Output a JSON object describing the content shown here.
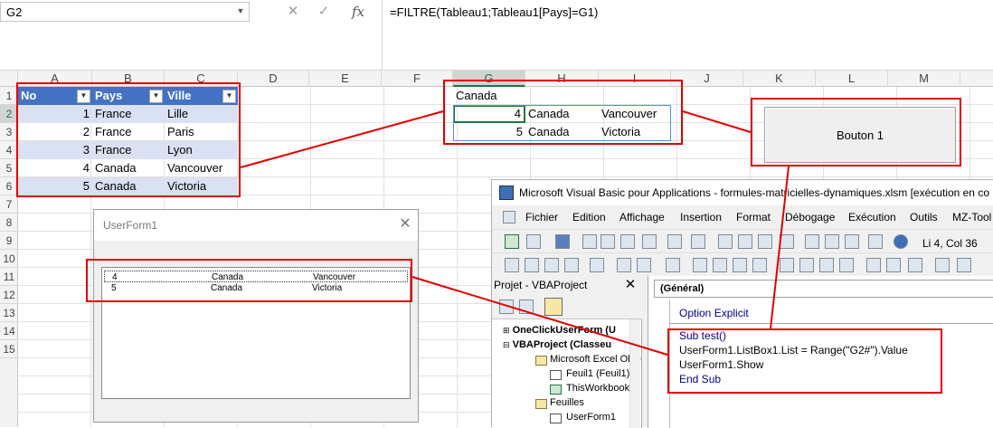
{
  "formula_bar": {
    "name_box": "G2",
    "cancel_symbol": "✕",
    "enter_symbol": "✓",
    "fx_label": "fx",
    "formula": "=FILTRE(Tableau1;Tableau1[Pays]=G1)"
  },
  "grid": {
    "columns": [
      "A",
      "B",
      "C",
      "D",
      "E",
      "F",
      "G",
      "H",
      "I",
      "J",
      "K",
      "L",
      "M"
    ],
    "rows": [
      "1",
      "2",
      "3",
      "4",
      "5",
      "6",
      "7",
      "8",
      "9",
      "10",
      "11",
      "12",
      "13",
      "14",
      "15"
    ]
  },
  "table1": {
    "headers": [
      "No",
      "Pays",
      "Ville"
    ],
    "rows": [
      [
        "1",
        "France",
        "Lille"
      ],
      [
        "2",
        "France",
        "Paris"
      ],
      [
        "3",
        "France",
        "Lyon"
      ],
      [
        "4",
        "Canada",
        "Vancouver"
      ],
      [
        "5",
        "Canada",
        "Victoria"
      ]
    ]
  },
  "filter_result": {
    "criteria": "Canada",
    "rows": [
      [
        "4",
        "Canada",
        "Vancouver"
      ],
      [
        "5",
        "Canada",
        "Victoria"
      ]
    ]
  },
  "button": {
    "label": "Bouton 1"
  },
  "userform": {
    "title": "UserForm1",
    "close_symbol": "✕",
    "listbox_rows": [
      [
        "4",
        "Canada",
        "Vancouver"
      ],
      [
        "5",
        "Canada",
        "Victoria"
      ]
    ]
  },
  "vbe": {
    "title": "Microsoft Visual Basic pour Applications - formules-matricielles-dynamiques.xlsm [exécution en co",
    "menu": [
      "Fichier",
      "Edition",
      "Affichage",
      "Insertion",
      "Format",
      "Débogage",
      "Exécution",
      "Outils",
      "MZ-Tool"
    ],
    "cursor_position": "Li 4, Col 36",
    "project_panel": {
      "title": "Projet - VBAProject",
      "close_symbol": "✕",
      "tree": [
        "OneClickUserForm (U",
        "VBAProject (Classeu",
        "Microsoft Excel Obje",
        "Feuil1 (Feuil1)",
        "ThisWorkbook",
        "Feuilles",
        "UserForm1"
      ]
    },
    "code": {
      "combo": "(Général)",
      "lines": [
        "Option Explicit",
        "Sub test()",
        "UserForm1.ListBox1.List = Range(\"G2#\").Value",
        "UserForm1.Show",
        "End Sub"
      ]
    }
  },
  "colors": {
    "table_header": "#4472c4",
    "table_band": "#d9e1f2",
    "callout": "#e00000",
    "excel_green": "#217346"
  }
}
